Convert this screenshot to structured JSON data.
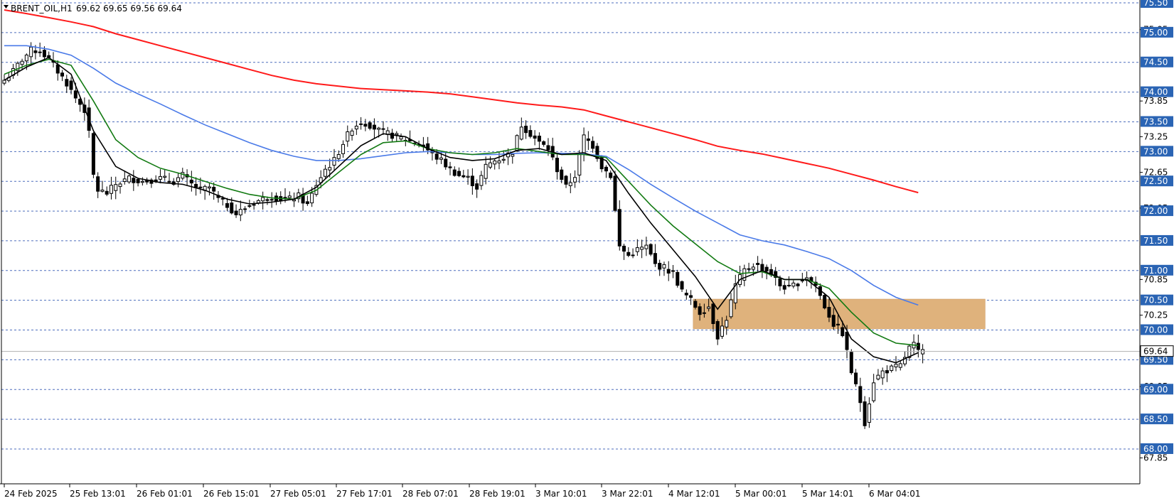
{
  "header": {
    "symbol": "BRENT_OIL,H1",
    "ohlc": "69.62 69.65 69.56 69.64"
  },
  "colors": {
    "background": "#ffffff",
    "grid_dash": "#3a5fb5",
    "badge_fill": "#2a64b4",
    "ma_red": "#ff1a1a",
    "ma_blue": "#4a7ae8",
    "ma_green": "#127a12",
    "ma_black": "#000000",
    "zone_fill": "#dfb27c",
    "current_price_line": "#b0b0b0"
  },
  "chart_data": {
    "type": "candlestick",
    "ylim": [
      67.68,
      75.58
    ],
    "y_ticks_plain": [
      "75.05",
      "73.85",
      "73.25",
      "72.65",
      "72.05",
      "70.85",
      "70.25",
      "69.05",
      "67.85"
    ],
    "y_ticks_badge": [
      "75.50",
      "75.00",
      "74.50",
      "74.00",
      "73.50",
      "73.00",
      "72.50",
      "72.00",
      "71.50",
      "71.00",
      "70.50",
      "70.00",
      "69.50",
      "69.00",
      "68.50",
      "68.00"
    ],
    "horizontal_levels": [
      75.5,
      75.0,
      74.5,
      74.0,
      73.5,
      73.0,
      72.5,
      72.0,
      71.5,
      71.0,
      70.5,
      70.0,
      69.5,
      69.0,
      68.5,
      68.0
    ],
    "current_price": 69.64,
    "current_price_label": "69.64",
    "x_ticks": [
      "24 Feb 2025",
      "25 Feb 13:01",
      "26 Feb 01:01",
      "26 Feb 15:01",
      "27 Feb 05:01",
      "27 Feb 17:01",
      "28 Feb 07:01",
      "28 Feb 19:01",
      "3 Mar 10:01",
      "3 Mar 22:01",
      "4 Mar 12:01",
      "5 Mar 00:01",
      "5 Mar 14:01",
      "6 Mar 04:01"
    ],
    "zone": {
      "low": 70.02,
      "high": 70.52,
      "from_bar": 155,
      "to_bar": 220
    },
    "close_anchors": [
      [
        0,
        74.2
      ],
      [
        2,
        74.35
      ],
      [
        4,
        74.55
      ],
      [
        6,
        74.7
      ],
      [
        8,
        74.7
      ],
      [
        10,
        74.55
      ],
      [
        12,
        74.35
      ],
      [
        14,
        74.15
      ],
      [
        16,
        73.9
      ],
      [
        18,
        73.7
      ],
      [
        19,
        73.3
      ],
      [
        20,
        72.6
      ],
      [
        21,
        72.35
      ],
      [
        23,
        72.3
      ],
      [
        25,
        72.45
      ],
      [
        28,
        72.55
      ],
      [
        31,
        72.5
      ],
      [
        35,
        72.55
      ],
      [
        38,
        72.5
      ],
      [
        40,
        72.6
      ],
      [
        42,
        72.45
      ],
      [
        44,
        72.35
      ],
      [
        46,
        72.4
      ],
      [
        48,
        72.2
      ],
      [
        50,
        72.1
      ],
      [
        52,
        71.95
      ],
      [
        54,
        72.05
      ],
      [
        56,
        72.15
      ],
      [
        58,
        72.2
      ],
      [
        60,
        72.25
      ],
      [
        62,
        72.2
      ],
      [
        64,
        72.2
      ],
      [
        66,
        72.25
      ],
      [
        68,
        72.1
      ],
      [
        70,
        72.45
      ],
      [
        72,
        72.7
      ],
      [
        74,
        72.85
      ],
      [
        76,
        73.15
      ],
      [
        78,
        73.4
      ],
      [
        80,
        73.5
      ],
      [
        82,
        73.45
      ],
      [
        84,
        73.35
      ],
      [
        86,
        73.3
      ],
      [
        88,
        73.25
      ],
      [
        90,
        73.2
      ],
      [
        92,
        73.15
      ],
      [
        94,
        73.1
      ],
      [
        96,
        72.95
      ],
      [
        98,
        72.85
      ],
      [
        100,
        72.7
      ],
      [
        102,
        72.6
      ],
      [
        104,
        72.55
      ],
      [
        106,
        72.4
      ],
      [
        108,
        72.75
      ],
      [
        110,
        72.85
      ],
      [
        112,
        72.9
      ],
      [
        114,
        73.0
      ],
      [
        116,
        73.45
      ],
      [
        118,
        73.3
      ],
      [
        120,
        73.15
      ],
      [
        122,
        73.05
      ],
      [
        124,
        72.7
      ],
      [
        126,
        72.4
      ],
      [
        128,
        72.6
      ],
      [
        130,
        73.25
      ],
      [
        132,
        73.1
      ],
      [
        134,
        72.75
      ],
      [
        136,
        72.6
      ],
      [
        138,
        71.4
      ],
      [
        140,
        71.25
      ],
      [
        142,
        71.35
      ],
      [
        144,
        71.4
      ],
      [
        146,
        71.1
      ],
      [
        148,
        71.05
      ],
      [
        150,
        70.95
      ],
      [
        152,
        70.65
      ],
      [
        154,
        70.5
      ],
      [
        156,
        70.3
      ],
      [
        158,
        70.4
      ],
      [
        160,
        69.9
      ],
      [
        162,
        70.2
      ],
      [
        164,
        70.75
      ],
      [
        166,
        71.0
      ],
      [
        168,
        71.1
      ],
      [
        170,
        71.05
      ],
      [
        172,
        70.95
      ],
      [
        174,
        70.75
      ],
      [
        176,
        70.7
      ],
      [
        178,
        70.8
      ],
      [
        180,
        70.9
      ],
      [
        182,
        70.75
      ],
      [
        184,
        70.4
      ],
      [
        186,
        70.1
      ],
      [
        188,
        69.95
      ],
      [
        190,
        69.3
      ],
      [
        192,
        68.8
      ],
      [
        193,
        68.45
      ],
      [
        195,
        69.15
      ],
      [
        197,
        69.3
      ],
      [
        199,
        69.35
      ],
      [
        201,
        69.4
      ],
      [
        203,
        69.7
      ],
      [
        204,
        69.75
      ],
      [
        205,
        69.62
      ],
      [
        206,
        69.64
      ]
    ],
    "moving_averages": [
      {
        "color": "#ff1a1a",
        "points": [
          [
            0,
            75.38
          ],
          [
            5,
            75.32
          ],
          [
            10,
            75.25
          ],
          [
            15,
            75.18
          ],
          [
            20,
            75.1
          ],
          [
            25,
            74.98
          ],
          [
            30,
            74.88
          ],
          [
            35,
            74.78
          ],
          [
            40,
            74.68
          ],
          [
            45,
            74.58
          ],
          [
            50,
            74.48
          ],
          [
            55,
            74.38
          ],
          [
            60,
            74.28
          ],
          [
            65,
            74.2
          ],
          [
            70,
            74.14
          ],
          [
            75,
            74.1
          ],
          [
            80,
            74.06
          ],
          [
            85,
            74.04
          ],
          [
            90,
            74.02
          ],
          [
            95,
            74.0
          ],
          [
            100,
            73.97
          ],
          [
            105,
            73.92
          ],
          [
            110,
            73.87
          ],
          [
            115,
            73.82
          ],
          [
            120,
            73.78
          ],
          [
            125,
            73.75
          ],
          [
            130,
            73.7
          ],
          [
            135,
            73.6
          ],
          [
            140,
            73.5
          ],
          [
            145,
            73.4
          ],
          [
            150,
            73.3
          ],
          [
            155,
            73.2
          ],
          [
            160,
            73.09
          ],
          [
            165,
            73.02
          ],
          [
            170,
            72.96
          ],
          [
            175,
            72.88
          ],
          [
            180,
            72.8
          ],
          [
            185,
            72.72
          ],
          [
            190,
            72.62
          ],
          [
            195,
            72.52
          ],
          [
            200,
            72.41
          ],
          [
            205,
            72.31
          ]
        ]
      },
      {
        "color": "#4a7ae8",
        "points": [
          [
            0,
            74.78
          ],
          [
            5,
            74.78
          ],
          [
            10,
            74.72
          ],
          [
            15,
            74.62
          ],
          [
            20,
            74.4
          ],
          [
            25,
            74.15
          ],
          [
            30,
            73.97
          ],
          [
            35,
            73.8
          ],
          [
            40,
            73.62
          ],
          [
            45,
            73.45
          ],
          [
            50,
            73.3
          ],
          [
            55,
            73.15
          ],
          [
            60,
            73.02
          ],
          [
            65,
            72.92
          ],
          [
            70,
            72.85
          ],
          [
            75,
            72.85
          ],
          [
            80,
            72.88
          ],
          [
            85,
            72.93
          ],
          [
            90,
            72.98
          ],
          [
            95,
            73.0
          ],
          [
            100,
            72.98
          ],
          [
            105,
            72.95
          ],
          [
            110,
            72.95
          ],
          [
            115,
            72.97
          ],
          [
            120,
            72.98
          ],
          [
            125,
            72.97
          ],
          [
            130,
            72.96
          ],
          [
            135,
            72.92
          ],
          [
            140,
            72.7
          ],
          [
            145,
            72.45
          ],
          [
            150,
            72.22
          ],
          [
            155,
            72.0
          ],
          [
            160,
            71.8
          ],
          [
            165,
            71.6
          ],
          [
            170,
            71.5
          ],
          [
            175,
            71.43
          ],
          [
            180,
            71.32
          ],
          [
            185,
            71.2
          ],
          [
            190,
            71.0
          ],
          [
            195,
            70.75
          ],
          [
            200,
            70.55
          ],
          [
            205,
            70.42
          ]
        ]
      },
      {
        "color": "#127a12",
        "points": [
          [
            0,
            74.3
          ],
          [
            5,
            74.45
          ],
          [
            10,
            74.55
          ],
          [
            15,
            74.45
          ],
          [
            20,
            73.85
          ],
          [
            25,
            73.2
          ],
          [
            30,
            72.9
          ],
          [
            35,
            72.72
          ],
          [
            40,
            72.62
          ],
          [
            45,
            72.5
          ],
          [
            50,
            72.38
          ],
          [
            55,
            72.28
          ],
          [
            60,
            72.22
          ],
          [
            65,
            72.2
          ],
          [
            70,
            72.35
          ],
          [
            75,
            72.65
          ],
          [
            80,
            72.95
          ],
          [
            85,
            73.15
          ],
          [
            90,
            73.18
          ],
          [
            95,
            73.05
          ],
          [
            100,
            72.98
          ],
          [
            105,
            72.95
          ],
          [
            110,
            72.98
          ],
          [
            115,
            73.05
          ],
          [
            120,
            73.0
          ],
          [
            125,
            72.95
          ],
          [
            130,
            72.95
          ],
          [
            135,
            72.9
          ],
          [
            140,
            72.5
          ],
          [
            145,
            72.1
          ],
          [
            150,
            71.75
          ],
          [
            155,
            71.45
          ],
          [
            160,
            71.15
          ],
          [
            165,
            70.95
          ],
          [
            170,
            70.98
          ],
          [
            175,
            70.85
          ],
          [
            180,
            70.85
          ],
          [
            185,
            70.7
          ],
          [
            190,
            70.3
          ],
          [
            195,
            69.95
          ],
          [
            200,
            69.78
          ],
          [
            205,
            69.74
          ]
        ]
      },
      {
        "color": "#000000",
        "points": [
          [
            0,
            74.2
          ],
          [
            5,
            74.42
          ],
          [
            10,
            74.58
          ],
          [
            15,
            74.3
          ],
          [
            20,
            73.35
          ],
          [
            25,
            72.75
          ],
          [
            30,
            72.55
          ],
          [
            35,
            72.48
          ],
          [
            40,
            72.45
          ],
          [
            45,
            72.35
          ],
          [
            50,
            72.2
          ],
          [
            55,
            72.12
          ],
          [
            60,
            72.15
          ],
          [
            65,
            72.2
          ],
          [
            70,
            72.4
          ],
          [
            75,
            72.75
          ],
          [
            80,
            73.1
          ],
          [
            85,
            73.3
          ],
          [
            90,
            73.25
          ],
          [
            95,
            73.05
          ],
          [
            100,
            72.9
          ],
          [
            105,
            72.85
          ],
          [
            110,
            72.88
          ],
          [
            115,
            73.02
          ],
          [
            120,
            73.05
          ],
          [
            125,
            72.95
          ],
          [
            130,
            72.98
          ],
          [
            135,
            72.85
          ],
          [
            140,
            72.3
          ],
          [
            145,
            71.8
          ],
          [
            150,
            71.35
          ],
          [
            155,
            70.9
          ],
          [
            160,
            70.35
          ],
          [
            165,
            70.85
          ],
          [
            170,
            71.0
          ],
          [
            175,
            70.85
          ],
          [
            180,
            70.85
          ],
          [
            185,
            70.55
          ],
          [
            190,
            69.85
          ],
          [
            195,
            69.55
          ],
          [
            200,
            69.45
          ],
          [
            205,
            69.62
          ]
        ]
      }
    ]
  }
}
